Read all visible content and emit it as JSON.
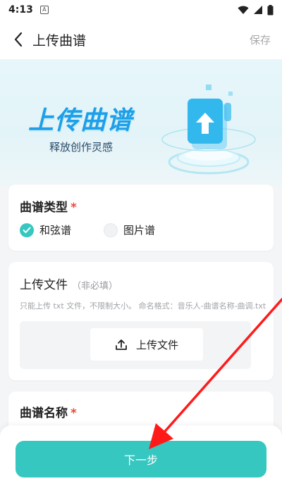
{
  "status_bar": {
    "time": "4:13",
    "notif_glyph": "A"
  },
  "app_bar": {
    "title": "上传曲谱",
    "save": "保存"
  },
  "banner": {
    "title": "上传曲谱",
    "subtitle": "释放创作灵感"
  },
  "score_type": {
    "title": "曲谱类型",
    "required": "*",
    "options": [
      {
        "label": "和弦谱",
        "checked": true
      },
      {
        "label": "图片谱",
        "checked": false
      }
    ]
  },
  "upload": {
    "title": "上传文件",
    "optional": "（非必填）",
    "hint": "只能上传 txt 文件，不限制大小。 命名格式：音乐人-曲谱名称-曲调.txt",
    "button": "上传文件"
  },
  "score_name": {
    "title": "曲谱名称",
    "required": "*"
  },
  "next_button": "下一步",
  "colors": {
    "accent": "#35c7c0",
    "banner_blue": "#1e9fe8",
    "arrow_red": "#ff1a1a"
  }
}
